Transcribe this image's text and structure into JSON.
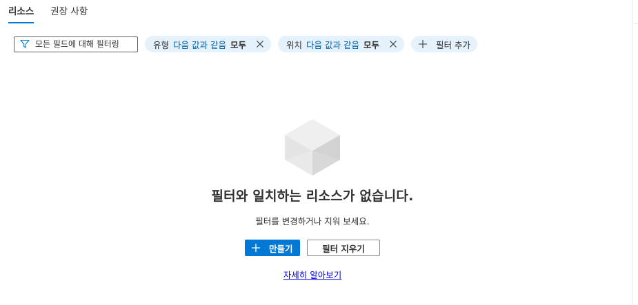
{
  "tabs": [
    {
      "label": "리소스",
      "active": true
    },
    {
      "label": "권장 사항",
      "active": false
    }
  ],
  "filter": {
    "placeholder": "모든 필드에 대해 필터링",
    "icon": "funnel-icon",
    "pills": [
      {
        "key": "유형",
        "operator": "다음 값과 같음",
        "value": "모두"
      },
      {
        "key": "위치",
        "operator": "다음 값과 같음",
        "value": "모두"
      }
    ],
    "add_label": "필터 추가"
  },
  "empty_state": {
    "icon": "cube-icon",
    "title": "필터와 일치하는 리소스가 없습니다.",
    "subtitle": "필터를 변경하거나 지워 보세요.",
    "create_label": "만들기",
    "clear_label": "필터 지우기",
    "learn_more_label": "자세히 알아보기"
  },
  "colors": {
    "accent": "#0078d4",
    "pill_background": "#e5f1fb",
    "operator_text": "#0063b1",
    "link": "#0000ee"
  }
}
